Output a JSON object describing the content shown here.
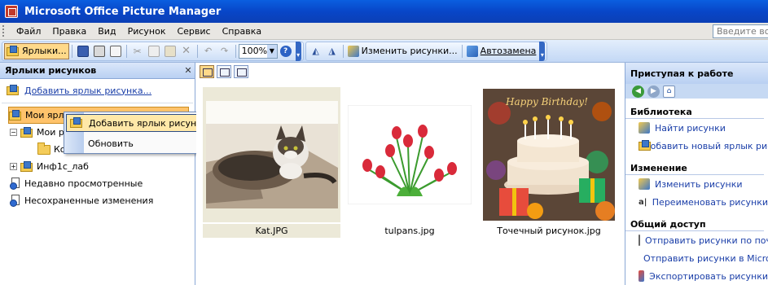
{
  "window": {
    "title": "Microsoft Office Picture Manager"
  },
  "menubar": {
    "items": [
      {
        "label": "Файл"
      },
      {
        "label": "Правка"
      },
      {
        "label": "Вид"
      },
      {
        "label": "Рисунок"
      },
      {
        "label": "Сервис"
      },
      {
        "label": "Справка"
      }
    ],
    "help_placeholder": "Введите вопрос"
  },
  "toolbar": {
    "shortcuts_label": "Ярлыки...",
    "zoom_value": "100%",
    "edit_pictures_label": "Изменить рисунки...",
    "autocorrect_label": "Автозамена"
  },
  "left_panel": {
    "title": "Ярлыки рисунков",
    "add_shortcut": "Добавить ярлык рисунка...",
    "tree": [
      {
        "label": "Мои ярлыки рисунков"
      },
      {
        "label": "Мои рисунки"
      },
      {
        "label": "Ко"
      },
      {
        "label": "Инф1с_лаб"
      }
    ],
    "recent": "Недавно просмотренные",
    "unsaved": "Несохраненные изменения"
  },
  "context_menu": {
    "items": [
      {
        "label": "Добавить ярлык рисунка..."
      },
      {
        "label": "Обновить"
      }
    ]
  },
  "thumbnails": [
    {
      "name": "Kat.JPG",
      "selected": true
    },
    {
      "name": "tulpans.jpg",
      "selected": false
    },
    {
      "name": "Точечный рисунок.jpg",
      "selected": false
    }
  ],
  "birthday_text": "Happy Birthday!",
  "right_panel": {
    "title": "Приступая к работе",
    "sections": [
      {
        "title": "Библиотека",
        "tasks": [
          {
            "label": "Найти рисунки"
          },
          {
            "label": "Добавить новый ярлык рисунка"
          }
        ]
      },
      {
        "title": "Изменение",
        "tasks": [
          {
            "label": "Изменить рисунки"
          },
          {
            "label": "Переименовать рисунки"
          }
        ]
      },
      {
        "title": "Общий доступ",
        "tasks": [
          {
            "label": "Отправить рисунки по почте"
          },
          {
            "label": "Отправить рисунки в Microsoft"
          },
          {
            "label": "Экспортировать рисунки"
          }
        ]
      }
    ]
  },
  "colors": {
    "titlebar": "#0846c8",
    "selection": "#ffc36b",
    "link": "#1a3ea8"
  }
}
